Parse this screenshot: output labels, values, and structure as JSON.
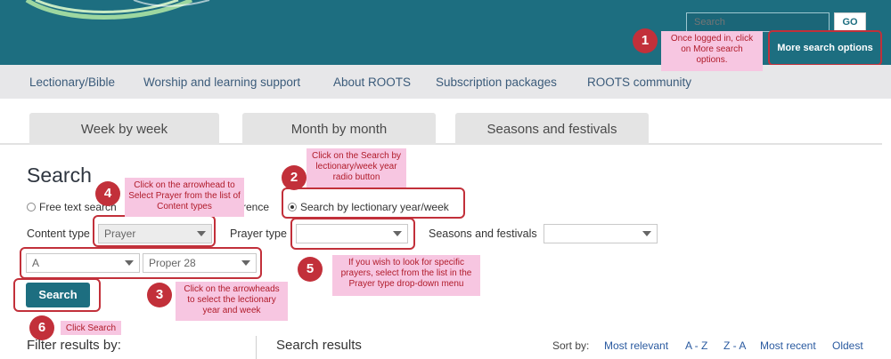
{
  "header": {
    "search_placeholder": "Search",
    "go_label": "GO",
    "more_search_label": "More search options"
  },
  "nav": {
    "items": [
      "Lectionary/Bible",
      "Worship and learning support",
      "About ROOTS",
      "Subscription packages",
      "ROOTS community"
    ]
  },
  "tabs": [
    "Week by week",
    "Month by month",
    "Seasons and festivals"
  ],
  "search_form": {
    "title": "Search",
    "radio_free_text": "Free text search",
    "radio_reference_fragment": "rence",
    "radio_lectionary": "Search by lectionary year/week",
    "content_type_label": "Content type",
    "content_type_value": "Prayer",
    "prayer_type_label": "Prayer type",
    "prayer_type_value": "",
    "seasons_label": "Seasons and festivals",
    "seasons_value": "",
    "year_value": "A",
    "week_value": "Proper 28",
    "search_button": "Search"
  },
  "annotations": [
    {
      "number": "1",
      "text": "Once logged in, click on More search options."
    },
    {
      "number": "2",
      "text": "Click on the Search by lectionary/week year radio button"
    },
    {
      "number": "3",
      "text": "Click on the arrowheads to select the lectionary year and week"
    },
    {
      "number": "4",
      "text": "Click on the arrowhead to Select Prayer from the list of Content types"
    },
    {
      "number": "5",
      "text": "If you wish to look for specific prayers, select from the list in the Prayer type drop-down menu"
    },
    {
      "number": "6",
      "text": "Click Search"
    }
  ],
  "results": {
    "filter_heading": "Filter results by:",
    "results_heading": "Search results",
    "sort_label": "Sort by:",
    "sort_options": [
      "Most relevant",
      "A - Z",
      "Z - A",
      "Most recent",
      "Oldest"
    ]
  },
  "colors": {
    "brand_teal": "#1d6e80",
    "highlight_red": "#c2303a",
    "note_pink": "#f7c6e1",
    "nav_bg": "#e7e7e9"
  }
}
